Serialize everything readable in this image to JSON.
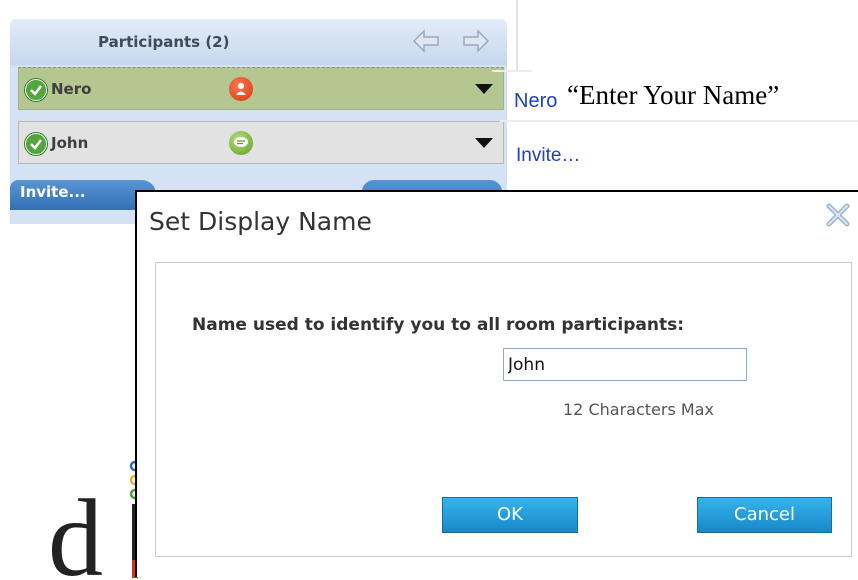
{
  "participants_panel": {
    "title": "Participants (2)",
    "icons": {
      "back": "arrow-left-icon",
      "forward": "arrow-right-icon"
    },
    "rows": [
      {
        "name": "Nero",
        "presence": "check-icon",
        "status_icon": "person-icon",
        "status_color": "#e03c12",
        "selected": true
      },
      {
        "name": "John",
        "presence": "check-icon",
        "status_icon": "chat-bubble-icon",
        "status_color": "#6aa82a",
        "selected": false
      }
    ],
    "invite_button": "Invite..."
  },
  "side": {
    "nero_link": "Nero",
    "annotation": "“Enter Your Name”",
    "invite_link": "Invite…"
  },
  "dialog": {
    "title": "Set Display Name",
    "close_icon": "close-x-icon",
    "prompt": "Name used to identify you to all room participants:",
    "input_value": "John",
    "limit_note": "12 Characters Max",
    "ok_label": "OK",
    "cancel_label": "Cancel"
  },
  "colors": {
    "panel_bg": "#d5e2f4",
    "selected_row": "#b5c791",
    "button_blue": "#2a9ed8",
    "link_blue": "#1f3fc0"
  }
}
